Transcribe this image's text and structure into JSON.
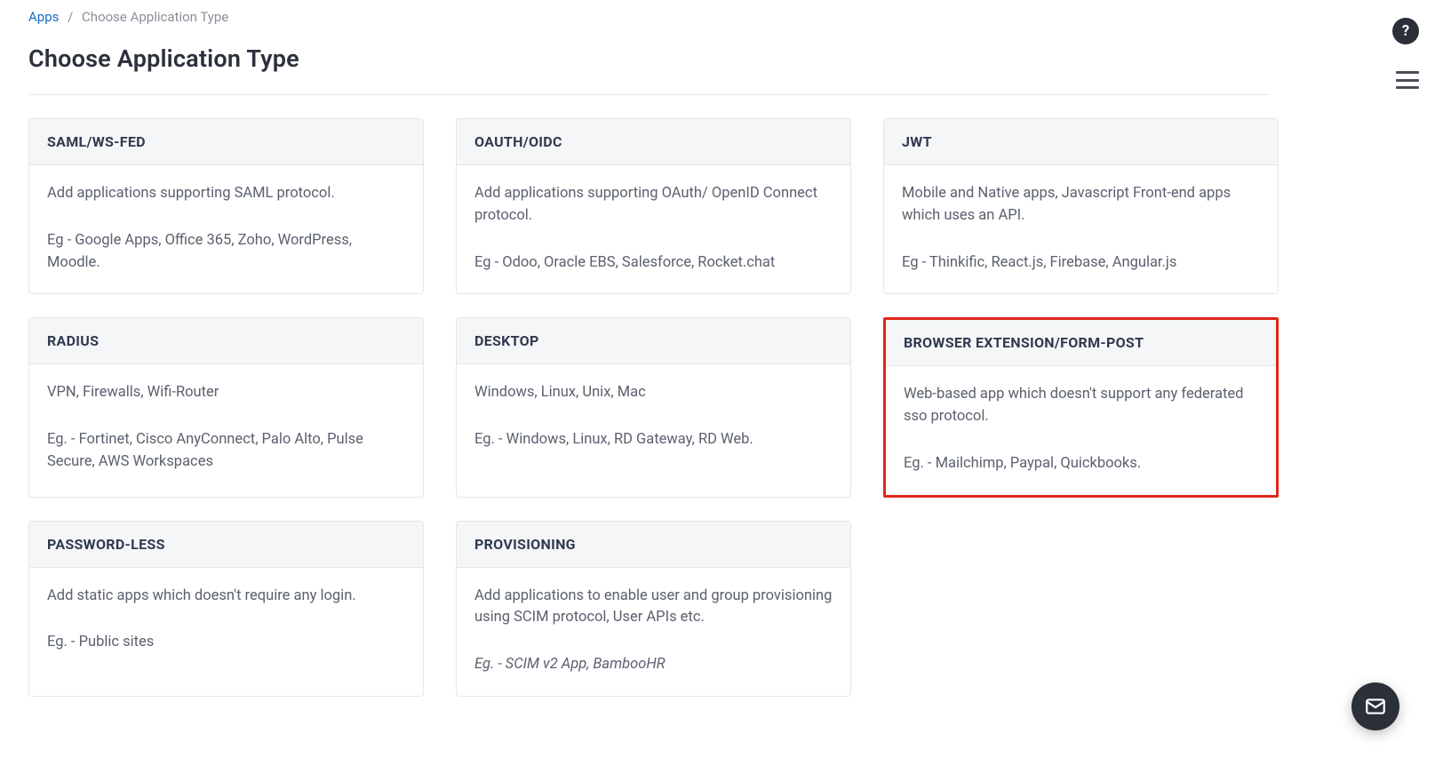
{
  "breadcrumb": {
    "root": "Apps",
    "current": "Choose Application Type"
  },
  "page_title": "Choose Application Type",
  "cards": [
    {
      "title": "SAML/WS-FED",
      "desc": "Add applications supporting SAML protocol.",
      "eg": "Eg - Google Apps, Office 365, Zoho, WordPress, Moodle.",
      "highlight": false,
      "eg_italic": false
    },
    {
      "title": "OAUTH/OIDC",
      "desc": "Add applications supporting OAuth/ OpenID Connect protocol.",
      "eg": "Eg - Odoo, Oracle EBS, Salesforce, Rocket.chat",
      "highlight": false,
      "eg_italic": false
    },
    {
      "title": "JWT",
      "desc": "Mobile and Native apps, Javascript Front-end apps which uses an API.",
      "eg": "Eg - Thinkific, React.js, Firebase, Angular.js",
      "highlight": false,
      "eg_italic": false
    },
    {
      "title": "RADIUS",
      "desc": "VPN, Firewalls, Wifi-Router",
      "eg": "Eg. - Fortinet, Cisco AnyConnect, Palo Alto, Pulse Secure, AWS Workspaces",
      "highlight": false,
      "eg_italic": false
    },
    {
      "title": "DESKTOP",
      "desc": "Windows, Linux, Unix, Mac",
      "eg": "Eg. - Windows, Linux, RD Gateway, RD Web.",
      "highlight": false,
      "eg_italic": false
    },
    {
      "title": "BROWSER EXTENSION/FORM-POST",
      "desc": "Web-based app which doesn't support any federated sso protocol.",
      "eg": "Eg. - Mailchimp, Paypal, Quickbooks.",
      "highlight": true,
      "eg_italic": false
    },
    {
      "title": "PASSWORD-LESS",
      "desc": "Add static apps which doesn't require any login.",
      "eg": "Eg. - Public sites",
      "highlight": false,
      "eg_italic": false
    },
    {
      "title": "PROVISIONING",
      "desc": "Add applications to enable user and group provisioning using SCIM protocol, User APIs etc.",
      "eg": "Eg. - SCIM v2 App, BambooHR",
      "highlight": false,
      "eg_italic": true
    }
  ]
}
